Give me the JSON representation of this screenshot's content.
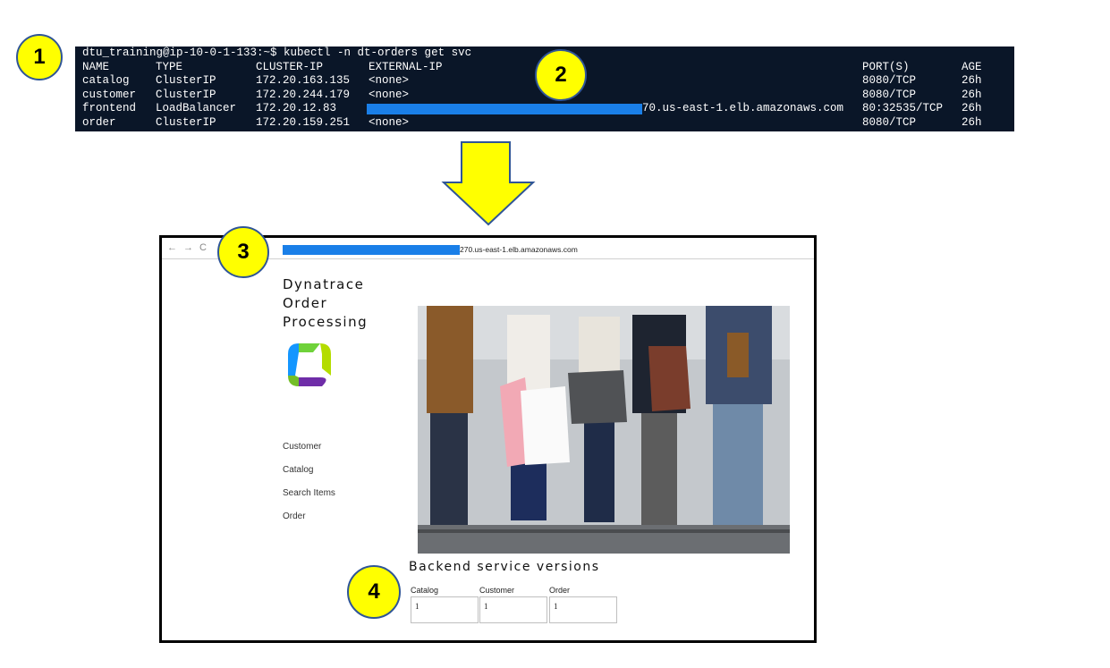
{
  "callouts": [
    "1",
    "2",
    "3",
    "4"
  ],
  "terminal": {
    "prompt": "dtu_training@ip-10-0-1-133:~$ kubectl -n dt-orders get svc",
    "headers": [
      "NAME",
      "TYPE",
      "CLUSTER-IP",
      "EXTERNAL-IP",
      "PORT(S)",
      "AGE"
    ],
    "rows": [
      {
        "name": "catalog",
        "type": "ClusterIP",
        "cluster_ip": "172.20.163.135",
        "external_ip": "<none>",
        "ports": "8080/TCP",
        "age": "26h"
      },
      {
        "name": "customer",
        "type": "ClusterIP",
        "cluster_ip": "172.20.244.179",
        "external_ip": "<none>",
        "ports": "8080/TCP",
        "age": "26h"
      },
      {
        "name": "frontend",
        "type": "LoadBalancer",
        "cluster_ip": "172.20.12.83",
        "external_ip": "70.us-east-1.elb.amazonaws.com",
        "ports": "80:32535/TCP",
        "age": "26h"
      },
      {
        "name": "order",
        "type": "ClusterIP",
        "cluster_ip": "172.20.159.251",
        "external_ip": "<none>",
        "ports": "8080/TCP",
        "age": "26h"
      }
    ],
    "redaction_color": "#1a7fe8"
  },
  "browser": {
    "url_suffix": "270.us-east-1.elb.amazonaws.com",
    "nav_icons": [
      "back-arrow-icon",
      "forward-arrow-icon",
      "reload-icon"
    ]
  },
  "site": {
    "title_lines": [
      "Dynatrace",
      "Order",
      "Processing"
    ],
    "nav": [
      "Customer",
      "Catalog",
      "Search Items",
      "Order"
    ],
    "backend_title": "Backend service versions",
    "versions": [
      {
        "label": "Catalog",
        "value": "1"
      },
      {
        "label": "Customer",
        "value": "1"
      },
      {
        "label": "Order",
        "value": "1"
      }
    ]
  },
  "colors": {
    "callout_fill": "#ffff00",
    "callout_border": "#2f5597",
    "terminal_bg": "#0a1628",
    "arrow_fill": "#ffff00"
  }
}
